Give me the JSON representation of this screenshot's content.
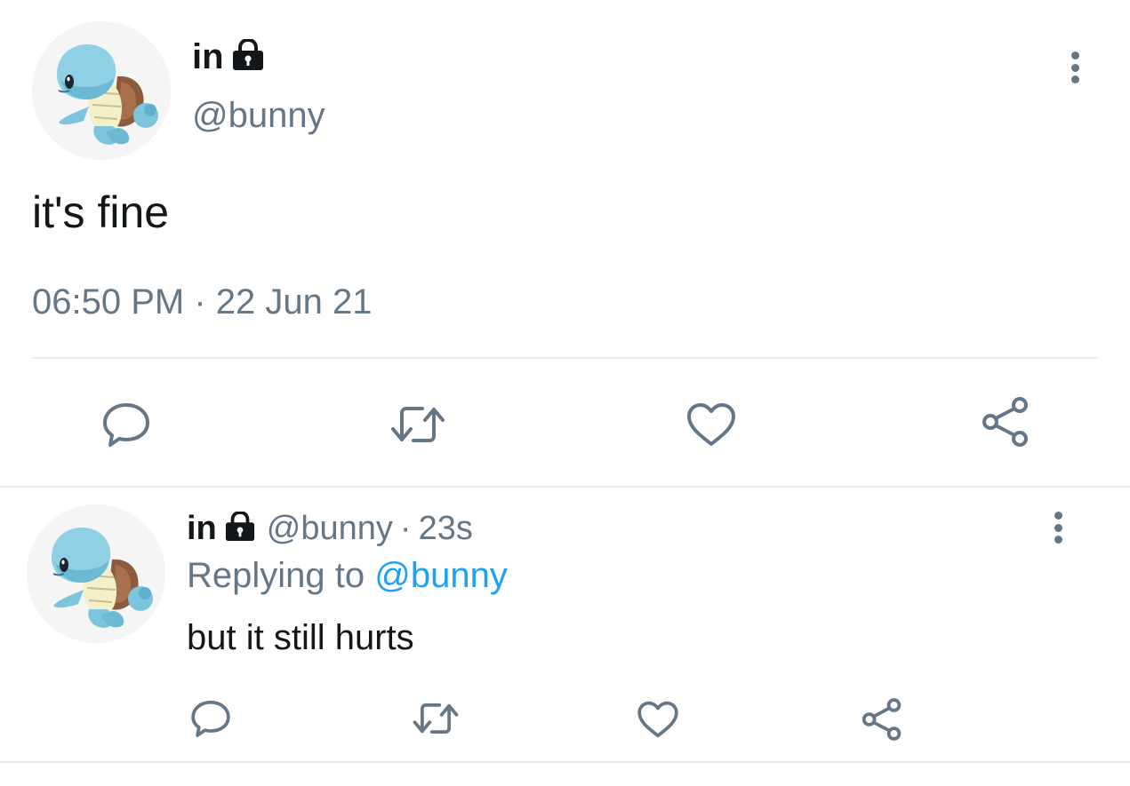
{
  "main_tweet": {
    "display_name": "in",
    "handle": "@bunny",
    "text": "it's fine",
    "timestamp": "06:50 PM · 22 Jun 21"
  },
  "reply_tweet": {
    "display_name": "in",
    "handle": "@bunny",
    "time_ago": "23s",
    "replying_prefix": "Replying to",
    "replying_to": "@bunny",
    "text": "but it still hurts"
  },
  "icons": {
    "lock": "lock-icon",
    "more": "more-vertical-icon",
    "reply": "reply-icon",
    "retweet": "retweet-icon",
    "like": "heart-icon",
    "share": "share-icon",
    "avatar": "squirtle-avatar"
  },
  "colors": {
    "text_primary": "#14171a",
    "text_secondary": "#657786",
    "link": "#1da1f2",
    "divider": "#e6ecf0",
    "icon": "#657786"
  }
}
